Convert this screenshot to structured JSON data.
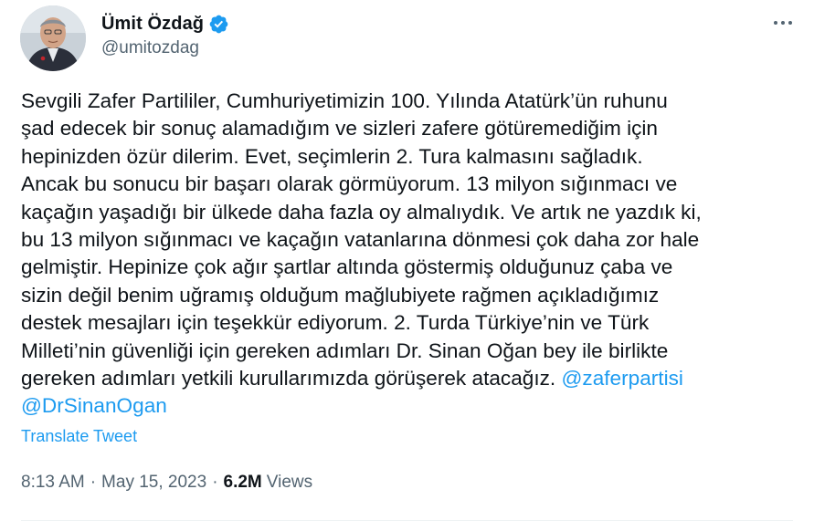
{
  "author": {
    "display_name": "Ümit Özdağ",
    "handle": "@umitozdag",
    "verified": true
  },
  "tweet": {
    "lines": [
      "Sevgili Zafer Partililer, Cumhuriyetimizin 100. Yılında Atatürk’ün ruhunu",
      "şad edecek bir sonuç alamadığım ve sizleri zafere götüremediğim için",
      "hepinizden özür dilerim. Evet, seçimlerin 2. Tura kalmasını sağladık.",
      "Ancak bu sonucu bir başarı olarak görmüyorum. 13 milyon sığınmacı ve",
      "kaçağın yaşadığı bir ülkede daha fazla oy almalıydık. Ve artık ne yazdık ki,",
      "bu 13 milyon sığınmacı ve kaçağın vatanlarına dönmesi çok daha zor hale",
      "gelmiştir. Hepinize çok ağır şartlar altında göstermiş olduğunuz çaba ve",
      "sizin değil benim uğramış olduğum mağlubiyete rağmen açıkladığımız",
      "destek mesajları için teşekkür ediyorum. 2. Turda Türkiye’nin ve Türk",
      "Milleti’nin güvenliği için gereken adımları Dr. Sinan Oğan bey ile birlikte",
      "gereken adımları yetkili kurullarımızda görüşerek atacağız. "
    ],
    "mention_1": "@zaferpartisi",
    "mention_2": "@DrSinanOgan"
  },
  "translate_label": "Translate Tweet",
  "meta": {
    "time": "8:13 AM",
    "separator": "·",
    "date": "May 15, 2023",
    "views_count": "6.2M",
    "views_label": "Views"
  },
  "icons": {
    "verified": "verified-badge-icon",
    "more": "more-options-icon"
  },
  "colors": {
    "accent": "#1d9bf0",
    "text": "#0f1419",
    "secondary": "#536471"
  }
}
